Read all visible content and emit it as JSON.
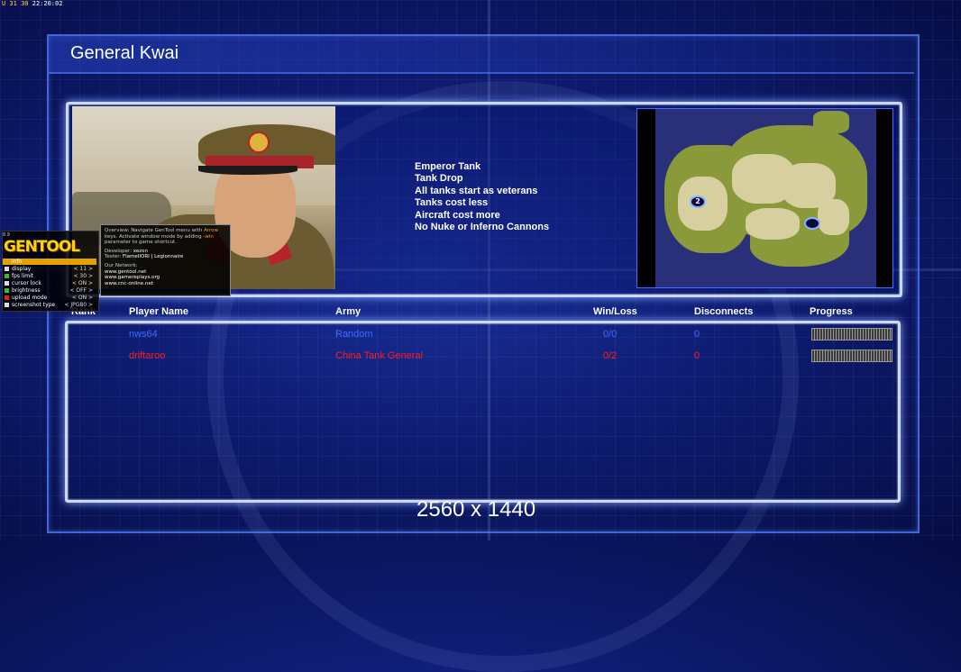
{
  "hud": {
    "stats": "U 31 30",
    "clock": "22:20:02"
  },
  "screen": {
    "title": "General Kwai",
    "resolution": "2560 x 1440"
  },
  "general_traits": [
    "Emperor Tank",
    "Tank Drop",
    "All tanks start as veterans",
    "Tanks cost less",
    "Aircraft cost more",
    "No Nuke or Inferno Cannons"
  ],
  "minimap": {
    "spawn_label": "2"
  },
  "table": {
    "headers": {
      "rank": "Rank",
      "player": "Player Name",
      "army": "Army",
      "winloss": "Win/Loss",
      "disconnects": "Disconnects",
      "progress": "Progress"
    },
    "rows": [
      {
        "player": "nws64",
        "army": "Random",
        "winloss": "0/0",
        "disconnects": "0",
        "color": "#3f6bff"
      },
      {
        "player": "driftaroo",
        "army": "China Tank General",
        "winloss": "0/2",
        "disconnects": "0",
        "color": "#ff1f1f"
      }
    ]
  },
  "gentool": {
    "version": "8.9",
    "logo": "GENTOOL",
    "menu": [
      {
        "label": "info",
        "value": "",
        "color": "#e6a100"
      },
      {
        "label": "display",
        "value": "< 11 >",
        "color": "#dddddd"
      },
      {
        "label": "fps limit",
        "value": "< 30 >",
        "color": "#2fbf2f"
      },
      {
        "label": "cursor lock",
        "value": "< ON >",
        "color": "#dddddd"
      },
      {
        "label": "brightness",
        "value": "< OFF >",
        "color": "#2fbf2f"
      },
      {
        "label": "upload mode",
        "value": "< ON >",
        "color": "#e02020"
      },
      {
        "label": "screenshot type",
        "value": "< JPG80 >",
        "color": "#dddddd"
      }
    ],
    "tip": {
      "overview_a": "Overview: Navigate GenTool menu with ",
      "arrow": "Arrow",
      "overview_b": " keys. Activate window mode by adding ",
      "win": "-win",
      "overview_c": " parameter to game shortcut.",
      "developer_label": "Developer: ",
      "developer": "xezon",
      "tester_label": "Tester: ",
      "tester": "FlameIIORI | Legionnaire",
      "network_label": "Our Network:",
      "links": [
        "www.gentool.net",
        "www.gamereplays.org",
        "www.cnc-online.net"
      ]
    }
  }
}
